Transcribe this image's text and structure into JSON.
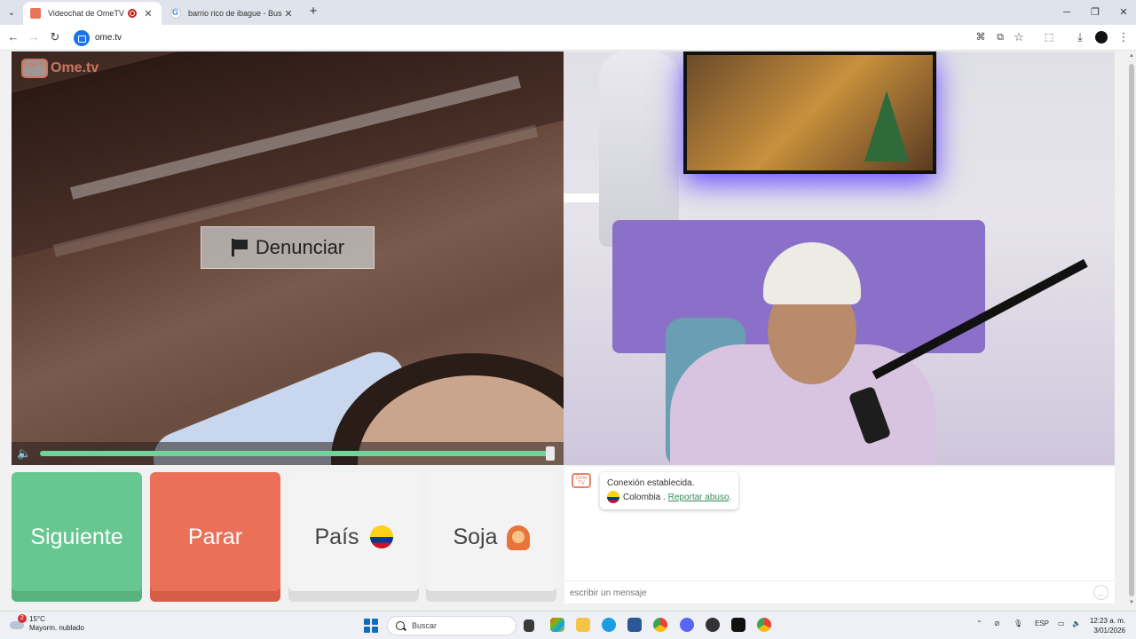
{
  "browser": {
    "tabs": [
      {
        "title": "Videochat de OmeTV: una",
        "active": true
      },
      {
        "title": "barrio rico de ibague - Buscar c",
        "active": false
      }
    ],
    "url": "ome.tv"
  },
  "logo": {
    "badge": "Ome TV",
    "text": "Ome.tv"
  },
  "video": {
    "report_button": "Denunciar",
    "volume_level": 1.0
  },
  "buttons": {
    "next": "Siguiente",
    "stop": "Parar",
    "country": "País",
    "gender": "Soja"
  },
  "chat": {
    "status": "Conexión establecida.",
    "country": "Colombia",
    "separator": " . ",
    "report_link": "Reportar abuso",
    "period": ".",
    "placeholder": "escribir un mensaje"
  },
  "taskbar": {
    "weather_temp": "15°C",
    "weather_desc": "Mayorm. nublado",
    "weather_badge": "2",
    "search_label": "Buscar",
    "language": "ESP",
    "time": "12:23 a. m.",
    "date": "3/01/2026"
  },
  "colors": {
    "next_button": "#67c791",
    "stop_button": "#ec6f58",
    "volume_track": "#6fd49a",
    "brand": "#e7826a"
  }
}
